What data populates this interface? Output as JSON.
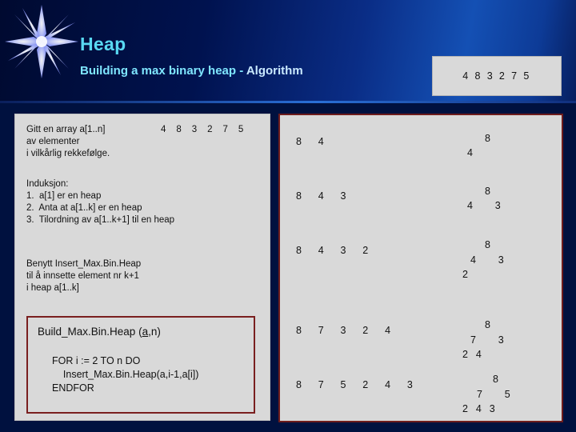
{
  "slide": {
    "title": "Heap",
    "subtitle_main": "Building a max binary heap",
    "subtitle_dash": "-",
    "subtitle_algo": "Algorithm"
  },
  "array_box": {
    "values": "4  8  3  2  7  5"
  },
  "left_panel": {
    "para1": "Gitt en array a[1..n]\nav elementer\ni vilkårlig rekkefølge.",
    "array_inline": "4  8  3  2  7  5",
    "para2": "Induksjon:\n1.  a[1] er en heap\n2.  Anta at a[1..k] er en heap\n3.  Tilordning av a[1..k+1] til en heap",
    "para3": "Benytt Insert_Max.Bin.Heap\ntil å innsette element nr k+1\ni heap a[1..k]",
    "build_title_pre": "Build_Max.Bin.Heap (",
    "build_title_underlined": "a",
    "build_title_post": ",n)",
    "build_code": "FOR i := 2 TO n DO\n    Insert_Max.Bin.Heap(a,i-1,a[i])\nENDFOR"
  },
  "right_panel": {
    "steps": [
      {
        "sequence": "8   4",
        "tree_rows": [
          "8",
          "4"
        ]
      },
      {
        "sequence": "8   4   3",
        "tree_rows": [
          "8",
          "4      3"
        ]
      },
      {
        "sequence": "8   4   3   2",
        "tree_rows": [
          "8",
          "4      3",
          "2"
        ]
      },
      {
        "sequence": "8   7   3   2   4",
        "tree_rows": [
          "8",
          "7      3",
          "2  4"
        ]
      },
      {
        "sequence": "8   7   5   2   4   3",
        "tree_rows": [
          "8",
          "7      5",
          "2  4  3"
        ]
      }
    ]
  },
  "colors": {
    "title": "#59d9f2",
    "subtitle": "#7fe6ff",
    "panel_bg": "#d9d9d9",
    "panel_border": "#6e1c1c",
    "background": "#00113f"
  }
}
